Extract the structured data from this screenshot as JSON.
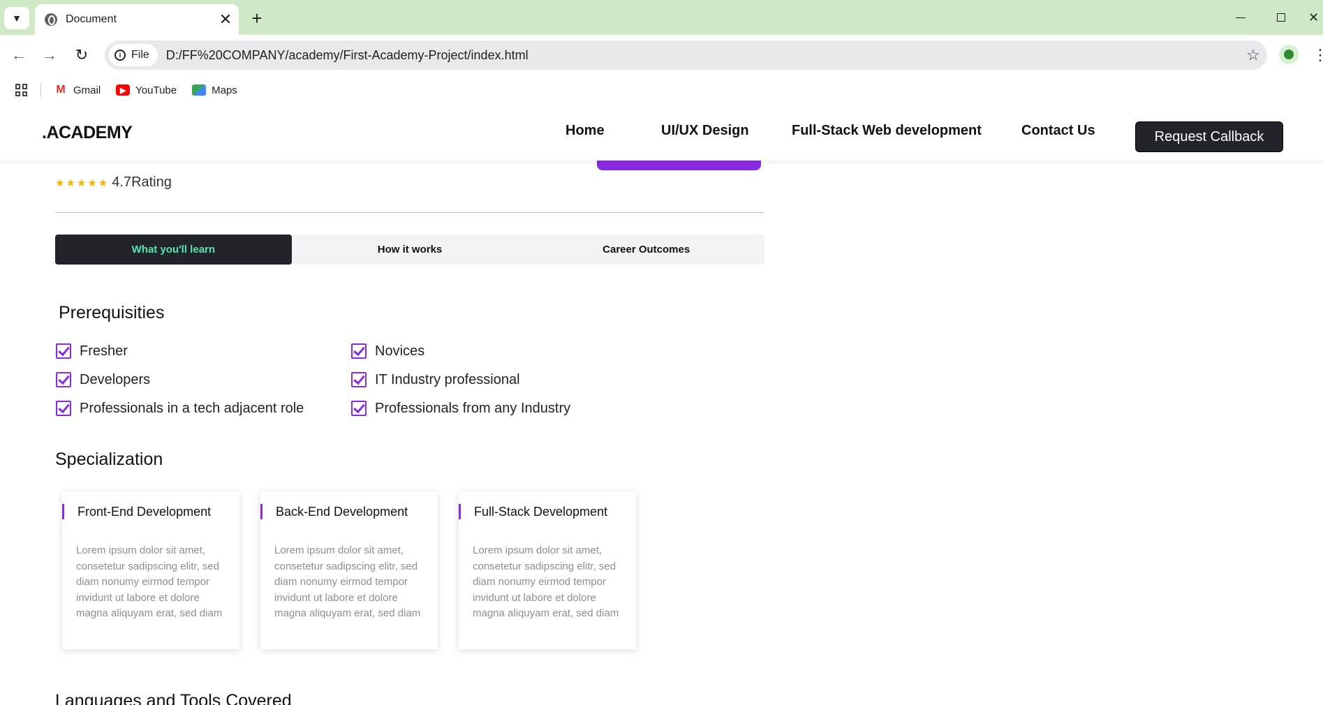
{
  "browser": {
    "tab_title": "Document",
    "close_glyph": "✕",
    "new_tab_glyph": "+",
    "file_chip": "File",
    "url": "D:/FF%20COMPANY/academy/First-Academy-Project/index.html",
    "bookmarks": [
      {
        "label": "Gmail",
        "icon": "gmail-icon"
      },
      {
        "label": "YouTube",
        "icon": "youtube-icon"
      },
      {
        "label": "Maps",
        "icon": "maps-icon"
      }
    ],
    "theme_color": "#cfe8c5"
  },
  "site": {
    "brand": ".ACADEMY",
    "nav": [
      "Home",
      "UI/UX Design",
      "Full-Stack Web development",
      "Contact Us"
    ],
    "cta": "Request Callback",
    "rating_value": "4.7",
    "rating_label": "Rating",
    "stars": "★★★★★",
    "tabs": [
      "What you'll learn",
      "How it works",
      "Career Outcomes"
    ],
    "active_tab": "What you'll learn",
    "prerequisites_title": "Prerequisities",
    "prerequisites": [
      "Fresher",
      "Novices",
      "Developers",
      "IT Industry professional",
      "Professionals in a tech adjacent role",
      "Professionals from any Industry"
    ],
    "specialization_title": "Specialization",
    "cards": [
      {
        "title": "Front-End Development",
        "text": "Lorem ipsum dolor sit amet, consetetur sadipscing elitr, sed diam nonumy eirmod tempor invidunt ut labore et dolore magna aliquyam erat, sed diam"
      },
      {
        "title": "Back-End Development",
        "text": "Lorem ipsum dolor sit amet, consetetur sadipscing elitr, sed diam nonumy eirmod tempor invidunt ut labore et dolore magna aliquyam erat, sed diam"
      },
      {
        "title": "Full-Stack Development",
        "text": "Lorem ipsum dolor sit amet, consetetur sadipscing elitr, sed diam nonumy eirmod tempor invidunt ut labore et dolore magna aliquyam erat, sed diam"
      }
    ],
    "languages_title": "Languages and Tools Covered",
    "accent_color": "#8a2be2",
    "active_tab_text_color": "#5ee3b0"
  }
}
